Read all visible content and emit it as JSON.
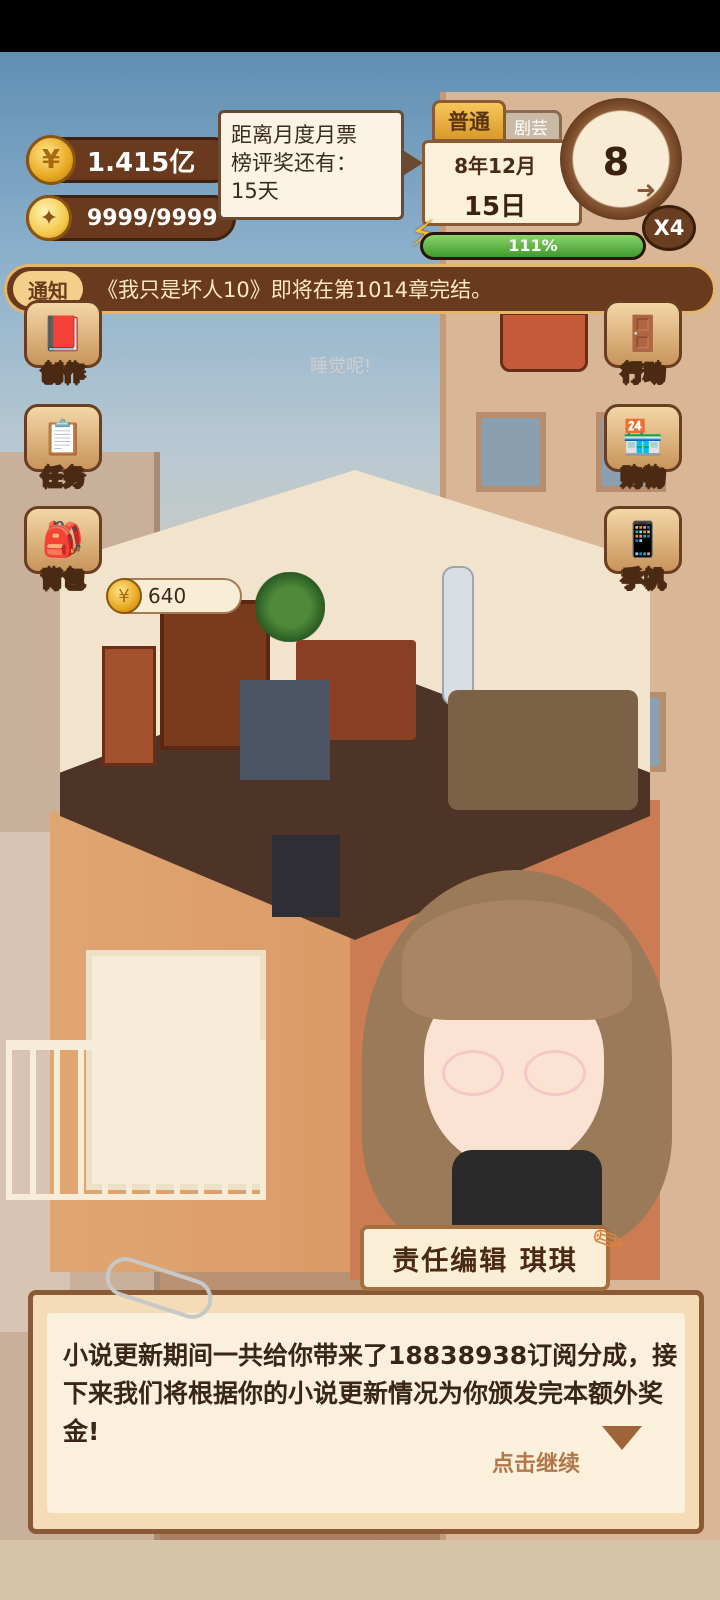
{
  "hud": {
    "coins": "1.415亿",
    "energy": "9999/9999",
    "coin_icon_glyph": "¥",
    "bulb_icon_glyph": "✦"
  },
  "tooltip": {
    "line1": "距离月度月票",
    "line2": "榜评奖还有：",
    "line3": "15天"
  },
  "date": {
    "mode": "普通",
    "tab2": "剧芸",
    "year_month": "8年12月",
    "day": "15日"
  },
  "clock": {
    "value": "8",
    "multiplier": "X4"
  },
  "progress": {
    "percent": 1.0,
    "label": "111%"
  },
  "notice": {
    "tag": "通知",
    "text": "《我只是坏人10》即将在第1014章完结。"
  },
  "side_left": [
    {
      "label": "创作",
      "icon": "book-icon"
    },
    {
      "label": "任务",
      "icon": "checklist-icon"
    },
    {
      "label": "背包",
      "icon": "backpack-icon"
    }
  ],
  "side_right": [
    {
      "label": "行动",
      "icon": "door-icon"
    },
    {
      "label": "购物",
      "icon": "shop-icon"
    },
    {
      "label": "手机",
      "icon": "phone-icon"
    }
  ],
  "scene": {
    "sleep_hint": "睡觉呢!",
    "item_price": "640"
  },
  "dialog": {
    "speaker": "责任编辑  琪琪",
    "text": "小说更新期间一共给你带来了18838938订阅分成，接下来我们将根据你的小说更新情况为你颁发完本额外奖金!",
    "continue_label": "点击继续"
  }
}
